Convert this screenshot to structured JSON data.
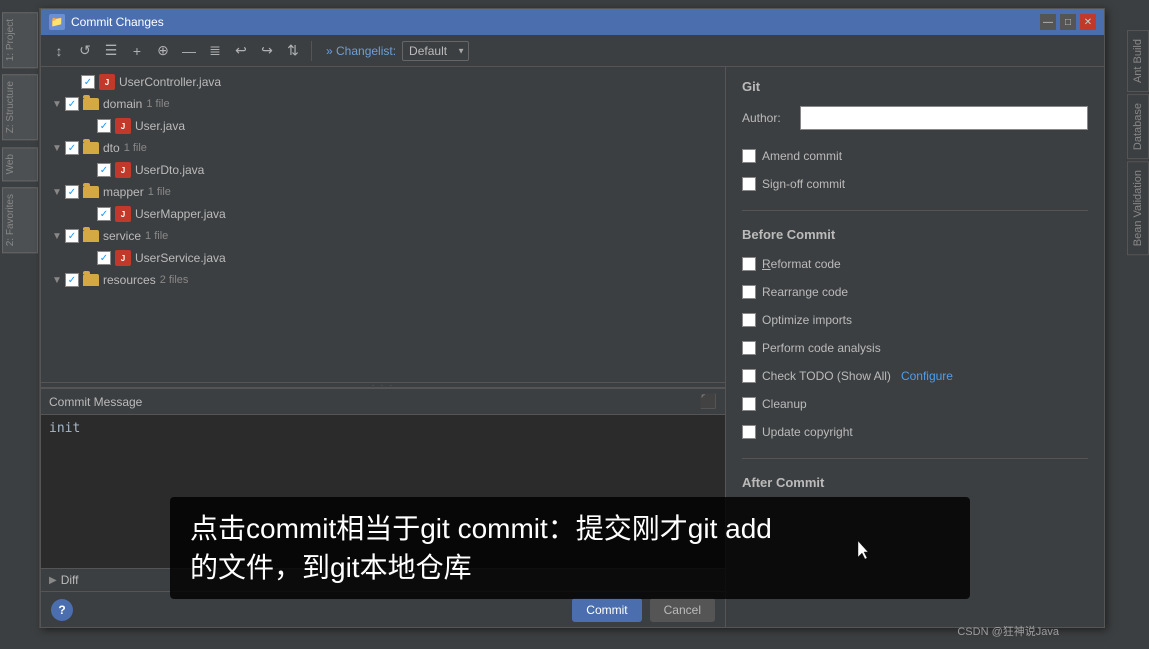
{
  "window": {
    "title": "Commit Changes"
  },
  "toolbar": {
    "changelist_label": "» Changelist:",
    "changelist_value": "Default",
    "buttons": [
      "↕",
      "↺",
      "≡",
      "+",
      "⊕",
      "—",
      "≣",
      "↩",
      "↪",
      "⇅"
    ]
  },
  "file_tree": {
    "items": [
      {
        "indent": 0,
        "type": "file",
        "checked": true,
        "name": "UserController.java",
        "count": ""
      },
      {
        "indent": 0,
        "type": "folder",
        "arrow": "▼",
        "checked": true,
        "name": "domain",
        "count": "1 file"
      },
      {
        "indent": 1,
        "type": "file",
        "checked": true,
        "name": "User.java",
        "count": ""
      },
      {
        "indent": 0,
        "type": "folder",
        "arrow": "▼",
        "checked": true,
        "name": "dto",
        "count": "1 file"
      },
      {
        "indent": 1,
        "type": "file",
        "checked": true,
        "name": "UserDto.java",
        "count": ""
      },
      {
        "indent": 0,
        "type": "folder",
        "arrow": "▼",
        "checked": true,
        "name": "mapper",
        "count": "1 file"
      },
      {
        "indent": 1,
        "type": "file",
        "checked": true,
        "name": "UserMapper.java",
        "count": ""
      },
      {
        "indent": 0,
        "type": "folder",
        "arrow": "▼",
        "checked": true,
        "name": "service",
        "count": "1 file"
      },
      {
        "indent": 1,
        "type": "file",
        "checked": true,
        "name": "UserService.java",
        "count": ""
      },
      {
        "indent": 0,
        "type": "folder",
        "arrow": "▼",
        "checked": true,
        "name": "resources",
        "count": "2 files"
      }
    ]
  },
  "commit_message": {
    "label": "Commit Message",
    "content": "init",
    "placeholder": ""
  },
  "diff_section": {
    "label": "Diff"
  },
  "bottom_buttons": {
    "commit_label": "Commit",
    "cancel_label": "Cancel"
  },
  "git_panel": {
    "title": "Git",
    "author_label": "Author:",
    "author_value": "",
    "amend_commit": "Amend commit",
    "sign_off_commit": "Sign-off commit",
    "before_commit_title": "Before Commit",
    "before_commit_items": [
      {
        "label": "Reformat code",
        "checked": false
      },
      {
        "label": "Rearrange code",
        "checked": false
      },
      {
        "label": "Optimize imports",
        "checked": false
      },
      {
        "label": "Perform code analysis",
        "checked": false
      },
      {
        "label": "Check TODO (Show All)",
        "checked": false,
        "link": "Configure"
      },
      {
        "label": "Cleanup",
        "checked": false
      },
      {
        "label": "Update copyright",
        "checked": false
      }
    ],
    "after_commit_title": "After Commit"
  },
  "caption": {
    "line1": "点击commit相当于git commit：提交刚才git add",
    "line2": "的文件，到git本地仓库"
  },
  "watermark": "CSDN @狂神说Java",
  "side_tabs": {
    "right": [
      "Ant Build",
      "Database",
      "Bean Validation"
    ],
    "left": [
      "1: Project",
      "2: Favorites",
      "Z: Structure",
      "Web"
    ]
  }
}
